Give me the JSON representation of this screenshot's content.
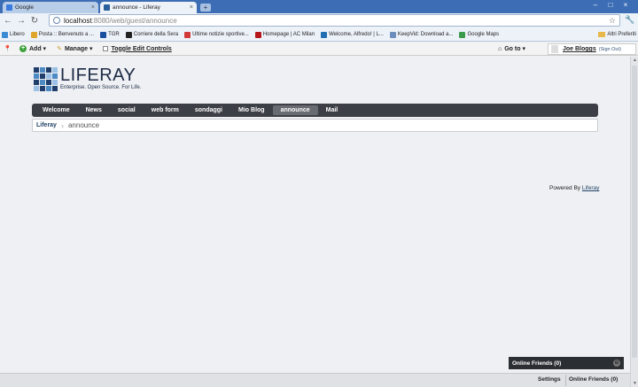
{
  "browser": {
    "tabs": [
      {
        "title": "Google",
        "favicon_color": "#3b7be0"
      },
      {
        "title": "announce - Liferay",
        "favicon_color": "#2a5e9c"
      }
    ],
    "url_host": "localhost",
    "url_path": ":8080/web/guest/announce",
    "bookmarks": [
      {
        "label": "Libero",
        "color": "#3a8bd4"
      },
      {
        "label": "Posta :: Benvenuto a ...",
        "color": "#e0a42c"
      },
      {
        "label": "TGR",
        "color": "#1a4fa0"
      },
      {
        "label": "Corriere della Sera",
        "color": "#222222"
      },
      {
        "label": "Ultime notizie sportive...",
        "color": "#d23a3a"
      },
      {
        "label": "Homepage | AC Milan",
        "color": "#b5161b"
      },
      {
        "label": "Welcome, Alfredo! | L...",
        "color": "#1f6fb2"
      },
      {
        "label": "KeepVid: Download a...",
        "color": "#6b8ebd"
      },
      {
        "label": "Google Maps",
        "color": "#3b9b4a"
      }
    ],
    "other_bookmarks": "Altri Preferiti"
  },
  "dockbar": {
    "add": "Add",
    "manage": "Manage",
    "toggle": "Toggle Edit Controls",
    "goto": "Go to",
    "user": "Joe Bloggs",
    "sign_out": "(Sign Out)"
  },
  "logo": {
    "title": "LIFERAY",
    "tagline": "Enterprise. Open Source. For Life.",
    "colors": [
      "#1f3e6b",
      "#4d8ac4",
      "#1f3e6b",
      "#9bc1e6",
      "#4d8ac4",
      "#1f3e6b",
      "#9bc1e6",
      "#4d8ac4",
      "#1f3e6b",
      "#4d8ac4",
      "#1f3e6b",
      "#9bc1e6",
      "#9bc1e6",
      "#1f3e6b",
      "#4d8ac4",
      "#1f3e6b"
    ]
  },
  "menu": [
    {
      "label": "Welcome",
      "selected": false
    },
    {
      "label": "News",
      "selected": false
    },
    {
      "label": "social",
      "selected": false
    },
    {
      "label": "web form",
      "selected": false
    },
    {
      "label": "sondaggi",
      "selected": false
    },
    {
      "label": "Mio Blog",
      "selected": false
    },
    {
      "label": "announce",
      "selected": true
    },
    {
      "label": "Mail",
      "selected": false
    }
  ],
  "breadcrumb": {
    "root": "Liferay",
    "current": "announce"
  },
  "footer": {
    "powered_by": "Powered By",
    "powered_link": "Liferay"
  },
  "chat": {
    "panel_title": "Online Friends (0)",
    "settings": "Settings",
    "online_friends": "Online Friends (0)"
  }
}
